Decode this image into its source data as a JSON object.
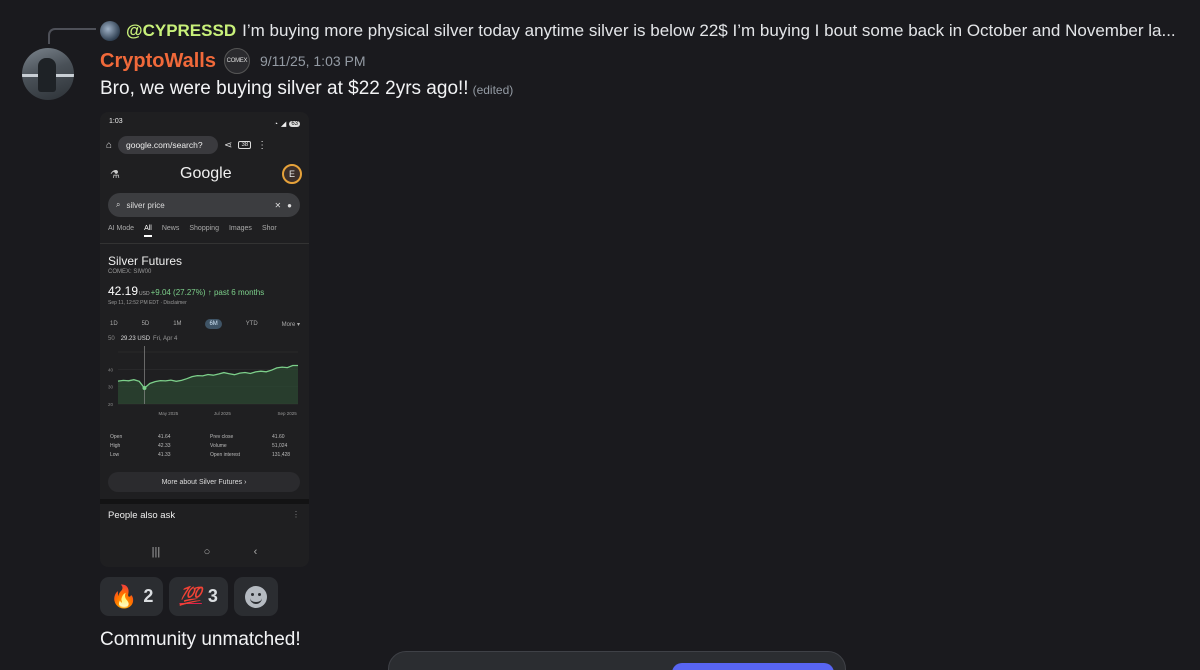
{
  "reply": {
    "username": "@CYPRESSD",
    "text": "I’m buying more physical silver today anytime silver is below 22$ I’m buying I bout some back in October and November la..."
  },
  "message": {
    "username": "CryptoWalls",
    "role_badge": "COMEX",
    "timestamp": "9/11/25, 1:03 PM",
    "text": "Bro, we were buying silver at $22 2yrs ago!!",
    "edited": "(edited)"
  },
  "screenshot": {
    "status_time": "1:03",
    "battery": "63",
    "url": "google.com/search?",
    "tab_count": "38",
    "logo": "Google",
    "account_initial": "E",
    "query": "silver price",
    "tabs": [
      "AI Mode",
      "All",
      "News",
      "Shopping",
      "Images",
      "Shor"
    ],
    "active_tab_index": 1,
    "title": "Silver Futures",
    "exchange": "COMEX: SIW00",
    "price": "42.19",
    "currency": "USD",
    "change": "+9.04 (27.27%) ↑ past 6 months",
    "as_of": "Sep 11, 12:52 PM EDT · Disclaimer",
    "ranges": [
      "1D",
      "5D",
      "1M",
      "6M",
      "YTD",
      "More ▾"
    ],
    "selected_range": "6M",
    "hover_value": "29.23 USD",
    "hover_date": "Fri, Apr 4",
    "stats": [
      [
        "Open",
        "41.64",
        "Prev close",
        "41.60"
      ],
      [
        "High",
        "42.33",
        "Volume",
        "51,024"
      ],
      [
        "Low",
        "41.33",
        "Open interest",
        "131,428"
      ]
    ],
    "more_link": "More about Silver Futures  ›",
    "people_also_ask": "People also ask"
  },
  "chart_data": {
    "type": "line",
    "title": "",
    "xlabel": "",
    "ylabel": "",
    "x_tick_labels": [
      "May 2025",
      "Jul 2025",
      "Sep 2025"
    ],
    "y_tick_labels": [
      "50",
      "40",
      "30",
      "20"
    ],
    "ylim": [
      20,
      50
    ],
    "series": [
      {
        "values": [
          33.2,
          33.6,
          33.4,
          34.0,
          33.1,
          29.2,
          31.8,
          32.9,
          33.5,
          33.3,
          33.8,
          33.1,
          33.6,
          34.6,
          35.8,
          36.4,
          36.2,
          37.0,
          36.6,
          37.3,
          38.1,
          37.5,
          36.9,
          37.8,
          38.2,
          37.6,
          38.5,
          38.9,
          38.6,
          39.5,
          40.8,
          41.3,
          41.0,
          42.2,
          42.19
        ]
      }
    ],
    "accent_color": "#7ccf8a"
  },
  "reactions": [
    {
      "emoji": "🔥",
      "count": "2"
    },
    {
      "emoji": "💯",
      "count": "3"
    }
  ],
  "followup": "Community unmatched!"
}
